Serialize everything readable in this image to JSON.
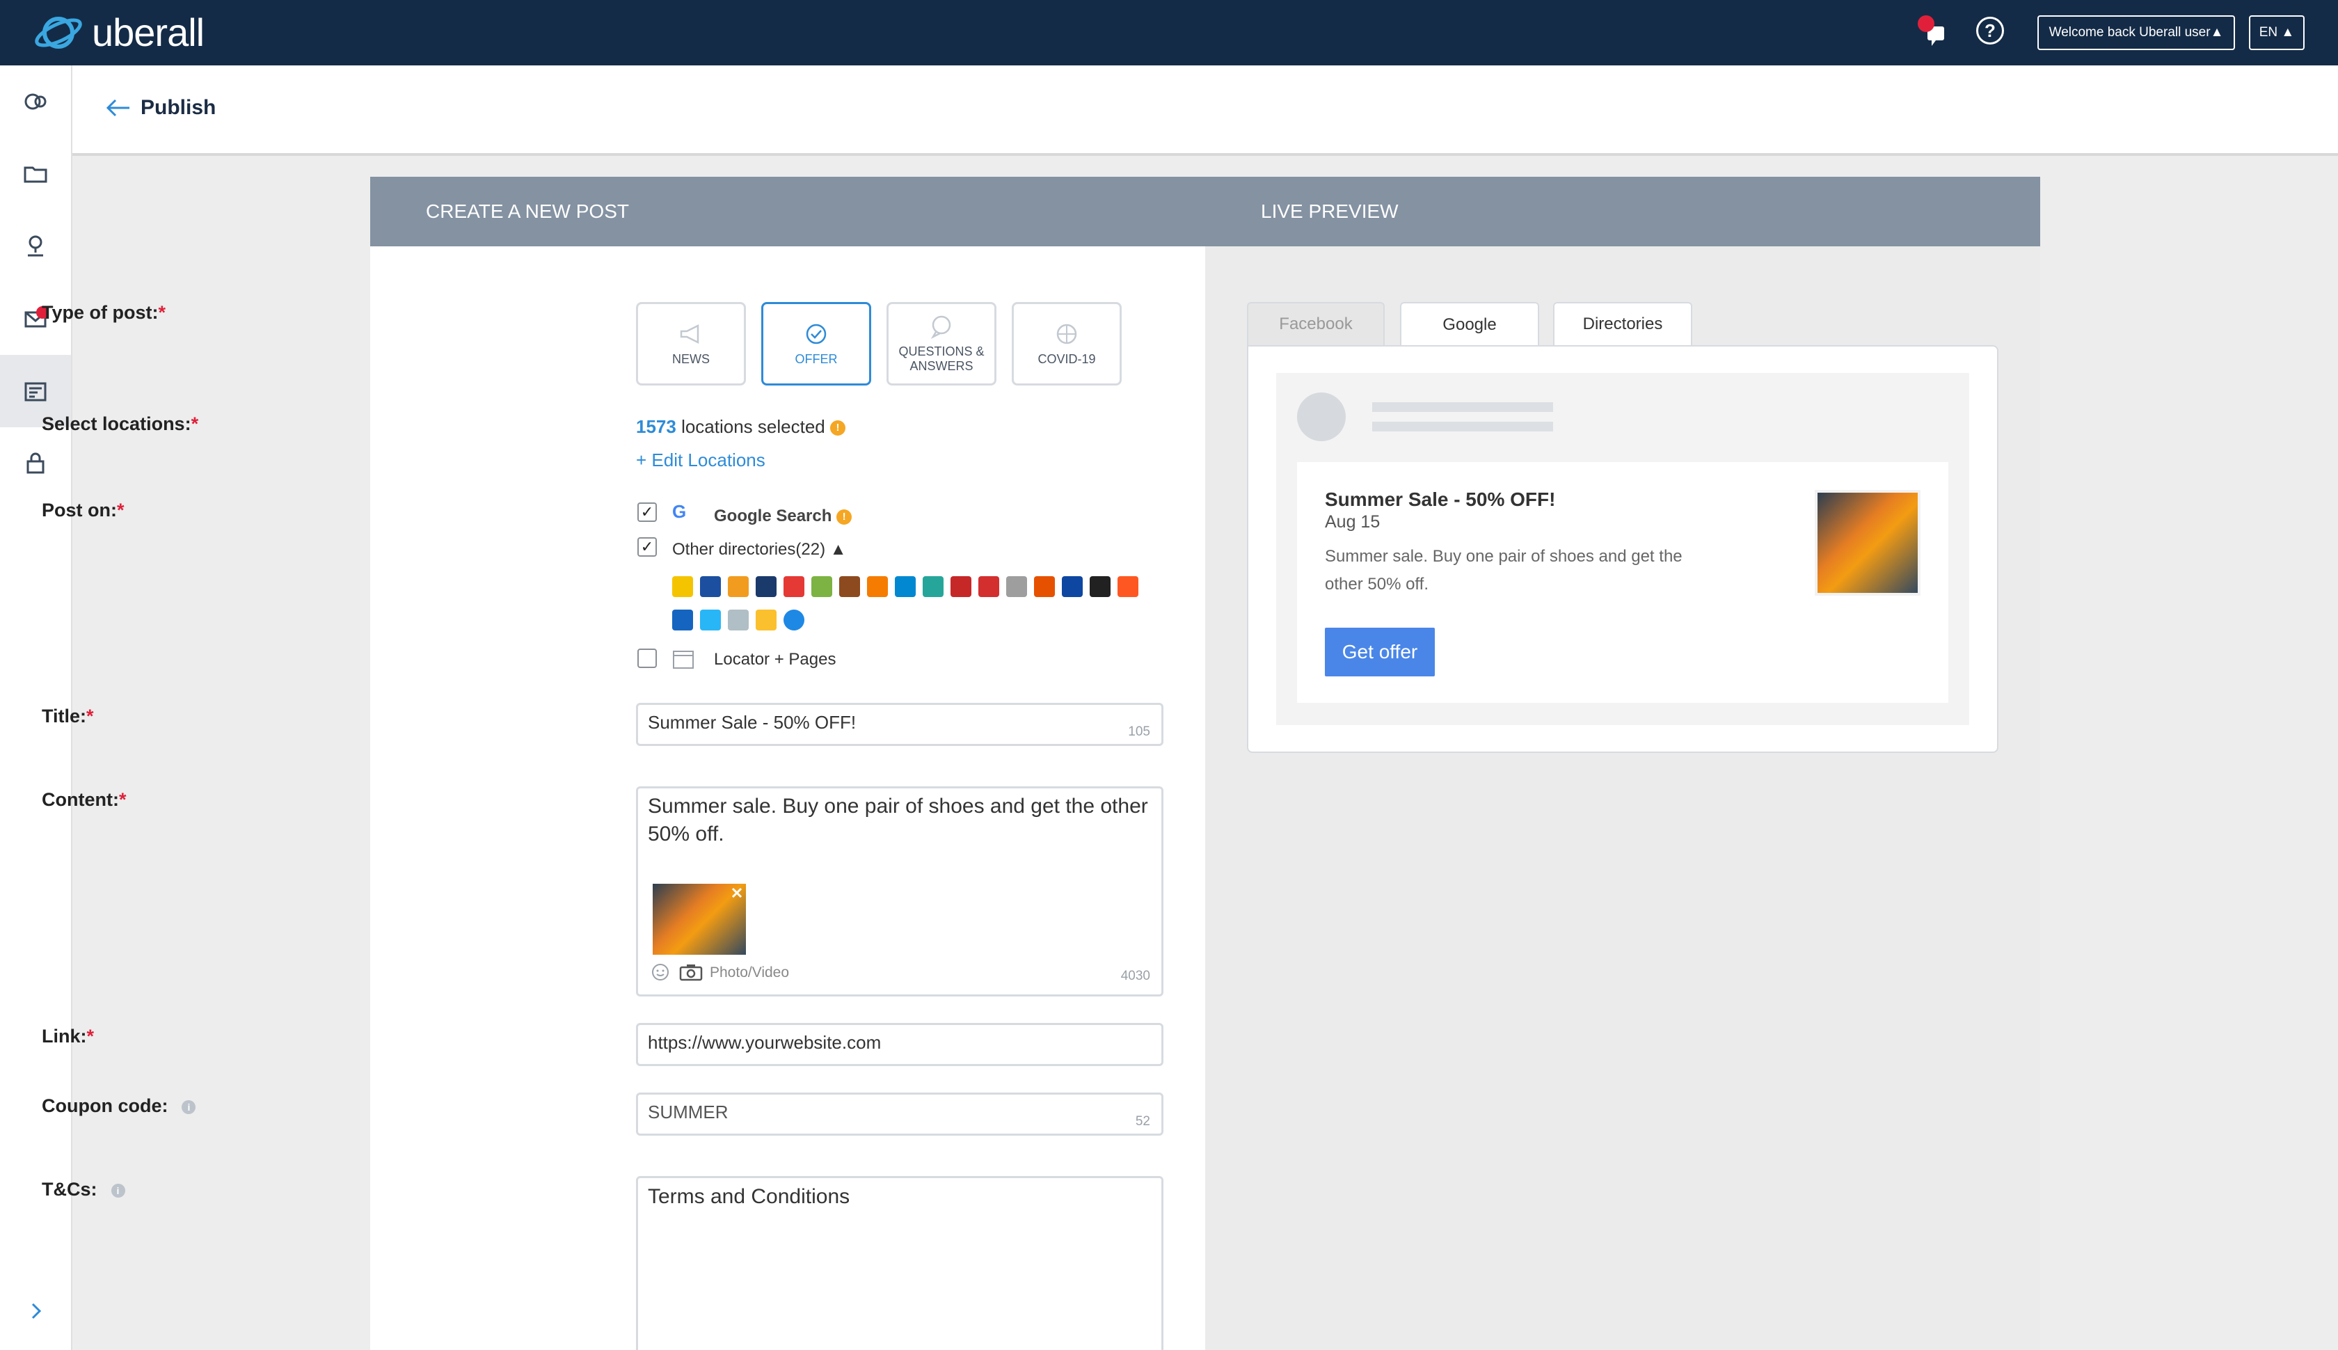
{
  "app": {
    "brand": "uberall",
    "user_button": "Welcome back Uberall user▲",
    "language": "EN ▲",
    "help_glyph": "?"
  },
  "subheader": {
    "title": "Publish"
  },
  "card": {
    "left_header": "CREATE A NEW POST",
    "right_header": "LIVE PREVIEW"
  },
  "form": {
    "type_label": "Type of post:",
    "post_types": [
      {
        "label": "NEWS",
        "icon": "megaphone-icon",
        "selected": false
      },
      {
        "label": "OFFER",
        "icon": "check-badge-icon",
        "selected": true
      },
      {
        "label": "QUESTIONS &\nANSWERS",
        "icon": "question-bubble-icon",
        "selected": false
      },
      {
        "label": "COVID-19",
        "icon": "globe-icon",
        "selected": false
      }
    ],
    "locations_label": "Select locations:",
    "locations_count": "1573",
    "locations_text": " locations selected ",
    "edit_locations": "+ Edit Locations",
    "post_on_label": "Post on:",
    "google_search": "Google Search",
    "other_directories": "Other directories(22) ▲",
    "locator_pages": "Locator + Pages",
    "title_label": "Title:",
    "title_value": "Summer Sale - 50% OFF!",
    "title_counter": "105",
    "content_label": "Content:",
    "content_value": "Summer sale. Buy one pair of shoes and get the other 50% off.",
    "content_counter": "4030",
    "photo_video": "Photo/Video",
    "link_label": "Link:",
    "link_value": "https://www.yourwebsite.com",
    "coupon_label": "Coupon code:",
    "coupon_value": "SUMMER",
    "coupon_counter": "52",
    "tcs_label": "T&Cs:",
    "tcs_value": "Terms and Conditions",
    "required_mark": "*",
    "info_glyph": "i",
    "warn_glyph": "!",
    "checkmark": "✓",
    "google_glyph": "G"
  },
  "directory_icon_colors": [
    "#f5c400",
    "#1c4fa0",
    "#f29c1f",
    "#1a3a6b",
    "#e53935",
    "#7cb342",
    "#8d4a1f",
    "#f57c00",
    "#0288d1",
    "#26a69a",
    "#c62828",
    "#d32f2f",
    "#9e9e9e",
    "#e65100",
    "#0d47a1",
    "#212121",
    "#ff5722",
    "#1565c0",
    "#29b6f6",
    "#b0bec5",
    "#fbc02d",
    "#1e88e5"
  ],
  "preview": {
    "tabs": [
      {
        "label": "Facebook",
        "active": false
      },
      {
        "label": "Google",
        "active": true
      },
      {
        "label": "Directories",
        "active": false
      }
    ],
    "offer_title": "Summer Sale - 50% OFF!",
    "offer_date": "Aug 15",
    "offer_text": "Summer sale. Buy one pair of shoes and get the other 50% off.",
    "cta": "Get offer"
  },
  "colors": {
    "topbar": "#142b47",
    "accent": "#2e8bd8",
    "required": "#e0203a",
    "cta": "#4a86e8"
  }
}
